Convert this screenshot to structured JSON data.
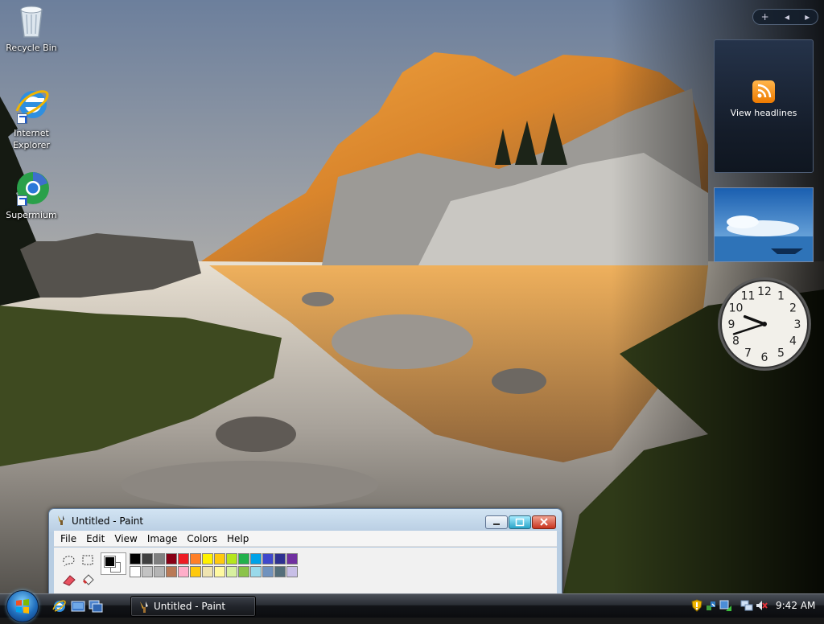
{
  "desktop": {
    "icons": [
      {
        "label": "Recycle Bin",
        "icon": "recycle-bin-icon"
      },
      {
        "label": "Internet Explorer",
        "icon": "internet-explorer-icon"
      },
      {
        "label": "Supermium",
        "icon": "supermium-icon"
      }
    ]
  },
  "sidebar": {
    "controls": {
      "add": "+",
      "prev": "◂",
      "next": "▸"
    },
    "feed_gadget": {
      "label": "View headlines",
      "icon": "rss-feed-icon"
    },
    "slideshow_gadget": {
      "icon": "slideshow-image"
    },
    "clock_gadget": {
      "numbers": [
        "12",
        "1",
        "2",
        "3",
        "4",
        "5",
        "6",
        "7",
        "8",
        "9",
        "10",
        "11"
      ],
      "time": "9:42"
    }
  },
  "paint_window": {
    "title": "Untitled - Paint",
    "menu": [
      "File",
      "Edit",
      "View",
      "Image",
      "Colors",
      "Help"
    ],
    "tools": [
      "free-form-select-icon",
      "rect-select-icon",
      "eraser-icon",
      "fill-icon"
    ],
    "foreground_color": "#000000",
    "background_color": "#FFFFFF",
    "palette_top": [
      "#000000",
      "#404040",
      "#7f7f7f",
      "#880015",
      "#ed1c24",
      "#ff7f27",
      "#fff200",
      "#ffc90e",
      "#b5e61d",
      "#22b14c",
      "#00a2e8",
      "#3f48cc",
      "#2e3192",
      "#7030a0"
    ],
    "palette_bottom": [
      "#ffffff",
      "#c3c3c3",
      "#b4b4b4",
      "#b97a57",
      "#ffaec9",
      "#ffc90e",
      "#efe4b0",
      "#fff9a0",
      "#d8f0a0",
      "#8bc34a",
      "#99d9ea",
      "#7092be",
      "#546e7a",
      "#c8bfe7"
    ]
  },
  "taskbar": {
    "task_button_label": "Untitled - Paint",
    "quick_launch": [
      "internet-explorer-icon",
      "show-desktop-icon",
      "switch-windows-icon"
    ],
    "tray_icons": [
      "security-warning-icon",
      "network-shield-icon",
      "windows-update-icon",
      "network-icon",
      "volume-muted-icon"
    ],
    "clock": "9:42 AM"
  },
  "colors": {
    "accent": "#1f6dbb",
    "taskbar": "#121418",
    "title_bar": "#c9dcf0"
  }
}
